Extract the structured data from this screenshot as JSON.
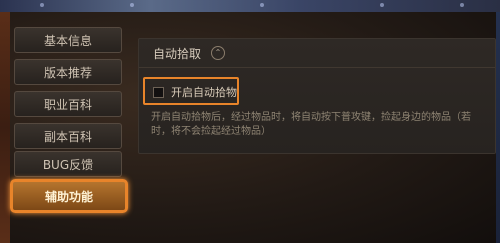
{
  "sidebar": {
    "items": [
      {
        "label": "基本信息"
      },
      {
        "label": "版本推荐"
      },
      {
        "label": "职业百科"
      },
      {
        "label": "副本百科"
      },
      {
        "label": "BUG反馈"
      },
      {
        "label": "辅助功能",
        "active": true
      }
    ]
  },
  "panel": {
    "section_title": "自动拾取",
    "collapse_icon": "chevron-up-icon",
    "option": {
      "label": "开启自动拾物",
      "checked": false
    },
    "description": "开启自动拾物后，经过物品时，将自动按下普攻键，捡起身边的物品（若时，将不会捡起经过物品）"
  },
  "colors": {
    "highlight_border": "#e8842a",
    "active_tab_bg": "#b5752e",
    "panel_bg": "#2e2925"
  }
}
